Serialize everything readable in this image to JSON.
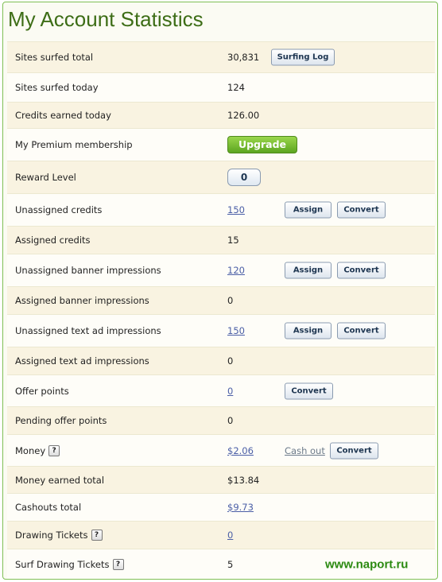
{
  "page": {
    "title": "My Account Statistics",
    "watermark": "www.naport.ru",
    "colors": {
      "title": "#3d6d16",
      "upgrade": "#5ca521",
      "link": "#4a5ea6"
    }
  },
  "rows": {
    "sites_surfed_total": {
      "label": "Sites surfed total",
      "value": "30,831",
      "button": "Surfing Log"
    },
    "sites_surfed_today": {
      "label": "Sites surfed today",
      "value": "124"
    },
    "credits_earned_today": {
      "label": "Credits earned today",
      "value": "126.00"
    },
    "premium": {
      "label": "My Premium membership",
      "button": "Upgrade"
    },
    "reward_level": {
      "label": "Reward Level",
      "value": "0"
    },
    "unassigned_credits": {
      "label": "Unassigned credits",
      "value": "150",
      "assign": "Assign",
      "convert": "Convert"
    },
    "assigned_credits": {
      "label": "Assigned credits",
      "value": "15"
    },
    "unassigned_banner": {
      "label": "Unassigned banner impressions",
      "value": "120",
      "assign": "Assign",
      "convert": "Convert"
    },
    "assigned_banner": {
      "label": "Assigned banner impressions",
      "value": "0"
    },
    "unassigned_text": {
      "label": "Unassigned text ad impressions",
      "value": "150",
      "assign": "Assign",
      "convert": "Convert"
    },
    "assigned_text": {
      "label": "Assigned text ad impressions",
      "value": "0"
    },
    "offer_points": {
      "label": "Offer points",
      "value": "0",
      "convert": "Convert"
    },
    "pending_offer_points": {
      "label": "Pending offer points",
      "value": "0"
    },
    "money": {
      "label": "Money",
      "help": "?",
      "value": "$2.06",
      "cashout": "Cash out",
      "convert": "Convert"
    },
    "money_earned_total": {
      "label": "Money earned total",
      "value": "$13.84"
    },
    "cashouts_total": {
      "label": "Cashouts total",
      "value": "$9.73"
    },
    "drawing_tickets": {
      "label": "Drawing Tickets",
      "help": "?",
      "value": "0"
    },
    "surf_drawing_tickets": {
      "label": "Surf Drawing Tickets",
      "help": "?",
      "value": "5"
    }
  }
}
